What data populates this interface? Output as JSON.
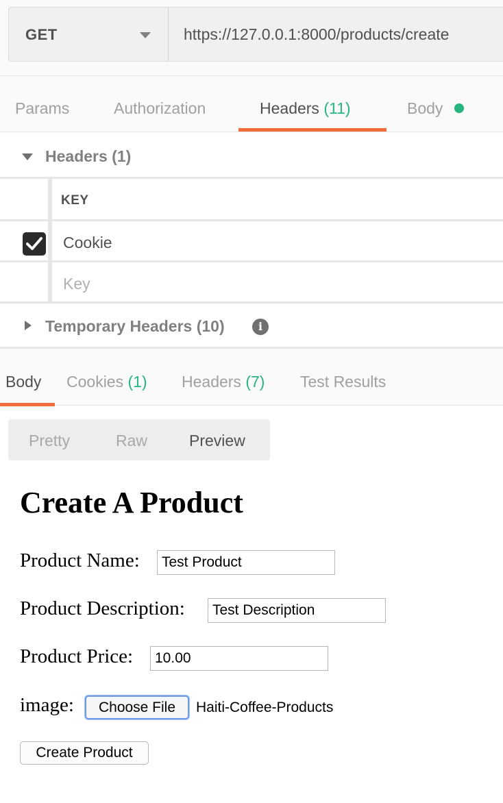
{
  "request": {
    "method": "GET",
    "url": "https://127.0.0.1:8000/products/create"
  },
  "request_tabs": [
    {
      "label": "Params",
      "count": ""
    },
    {
      "label": "Authorization",
      "count": ""
    },
    {
      "label": "Headers",
      "count": "(11)"
    },
    {
      "label": "Body",
      "count": ""
    }
  ],
  "headers_section": {
    "title": "Headers",
    "count": "(1)",
    "column_key": "KEY",
    "rows": [
      {
        "key": "Cookie",
        "checked": true
      }
    ],
    "new_key_placeholder": "Key"
  },
  "temporary_headers": {
    "title": "Temporary Headers",
    "count": "(10)",
    "info_icon": "i"
  },
  "response_tabs": [
    {
      "label": "Body",
      "count": ""
    },
    {
      "label": "Cookies",
      "count": "(1)"
    },
    {
      "label": "Headers",
      "count": "(7)"
    },
    {
      "label": "Test Results",
      "count": ""
    }
  ],
  "view_modes": [
    "Pretty",
    "Raw",
    "Preview"
  ],
  "preview": {
    "title": "Create A Product",
    "fields": [
      {
        "label": "Product Name:",
        "value": "Test Product"
      },
      {
        "label": "Product Description:",
        "value": "Test Description"
      },
      {
        "label": "Product Price:",
        "value": "10.00"
      }
    ],
    "image_label": "image:",
    "file_button": "Choose File",
    "file_name": "Haiti-Coffee-Products",
    "submit_label": "Create Product"
  },
  "colors": {
    "accent": "#f26b3a",
    "count_green": "#26b47f"
  }
}
